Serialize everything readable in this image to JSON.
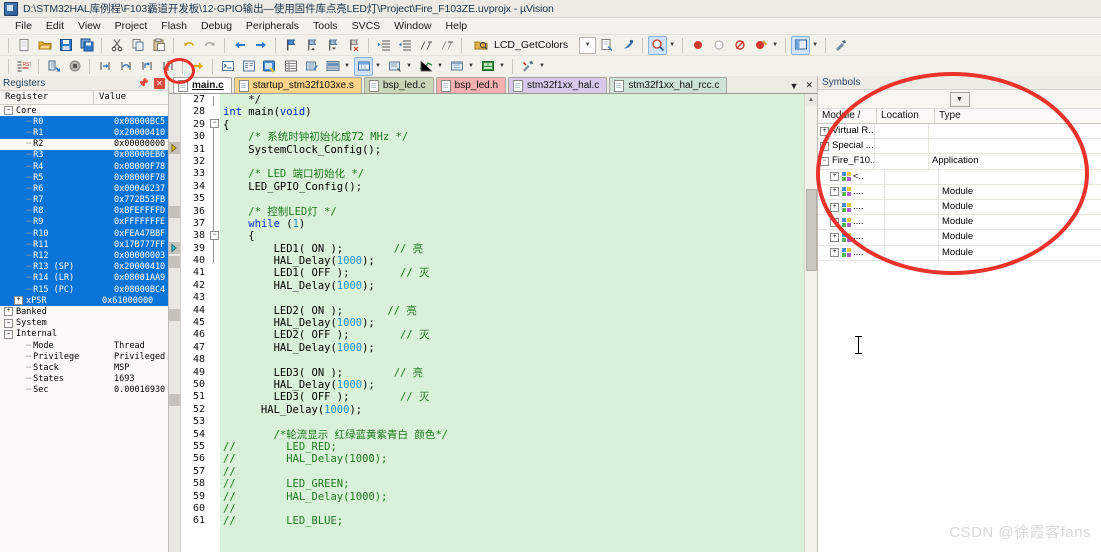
{
  "window": {
    "title": "D:\\STM32HAL库例程\\F103霸道开发板\\12-GPIO输出—使用固件库点亮LED灯\\Project\\Fire_F103ZE.uvprojx - µVision",
    "logo_name": "uvision-logo"
  },
  "menubar": {
    "items": [
      "File",
      "Edit",
      "View",
      "Project",
      "Flash",
      "Debug",
      "Peripherals",
      "Tools",
      "SVCS",
      "Window",
      "Help"
    ]
  },
  "toolbar1": {
    "combo_value": "LCD_GetColors",
    "icons": [
      "new-file-icon",
      "open-file-icon",
      "save-icon",
      "save-all-icon",
      "cut-icon",
      "copy-icon",
      "paste-icon",
      "undo-icon",
      "redo-icon",
      "navigate-back-icon",
      "navigate-forward-icon",
      "bookmark-toggle-icon",
      "bookmark-prev-icon",
      "bookmark-next-icon",
      "bookmark-clear-icon",
      "indent-icon",
      "outdent-icon",
      "comment-icon",
      "uncomment-icon",
      "find-in-files-icon"
    ],
    "right_icons": [
      "combo-dropdown-icon",
      "browse-symbol-icon",
      "insert-bookmark-icon",
      "find-icon",
      "breakpoint-icon",
      "disable-breakpoint-icon",
      "kill-all-breakpoints-icon",
      "disable-all-breakpoints-icon",
      "project-window-icon",
      "configure-icon"
    ]
  },
  "toolbar2": {
    "icons": [
      "reset-cpu-icon",
      "run-icon",
      "stop-icon",
      "step-icon",
      "step-over-icon",
      "step-out-icon",
      "run-to-cursor-icon",
      "show-next-statement-icon",
      "command-window-icon",
      "disassembly-window-icon",
      "symbols-window-icon",
      "registers-window-icon",
      "call-stack-icon",
      "watch-window-icon",
      "memory-window-icon",
      "serial-window-icon",
      "analysis-window-icon",
      "trace-window-icon",
      "system-viewer-icon",
      "toolbox-icon"
    ],
    "highlighted_icon": "symbols-window-icon"
  },
  "registers_pane": {
    "title": "Registers",
    "pin_icon": "pin-icon",
    "close_icon": "close-icon",
    "columns": [
      "Register",
      "Value"
    ],
    "rows": [
      {
        "name": "Core",
        "value": "",
        "indent": 0,
        "expander": "-",
        "selected": false
      },
      {
        "name": "R0",
        "value": "0x08000BC5",
        "indent": 2,
        "expander": "",
        "selected": true
      },
      {
        "name": "R1",
        "value": "0x20000410",
        "indent": 2,
        "expander": "",
        "selected": true
      },
      {
        "name": "R2",
        "value": "0x00000000",
        "indent": 2,
        "expander": "",
        "selected": false
      },
      {
        "name": "R3",
        "value": "0x08000EB6",
        "indent": 2,
        "expander": "",
        "selected": true
      },
      {
        "name": "R4",
        "value": "0x08000F78",
        "indent": 2,
        "expander": "",
        "selected": true
      },
      {
        "name": "R5",
        "value": "0x08000F78",
        "indent": 2,
        "expander": "",
        "selected": true
      },
      {
        "name": "R6",
        "value": "0x00046237",
        "indent": 2,
        "expander": "",
        "selected": true
      },
      {
        "name": "R7",
        "value": "0x772B53FB",
        "indent": 2,
        "expander": "",
        "selected": true
      },
      {
        "name": "R8",
        "value": "0xBFEFFFFD",
        "indent": 2,
        "expander": "",
        "selected": true
      },
      {
        "name": "R9",
        "value": "0xFFFFFFFE",
        "indent": 2,
        "expander": "",
        "selected": true
      },
      {
        "name": "R10",
        "value": "0xFEA47BBF",
        "indent": 2,
        "expander": "",
        "selected": true
      },
      {
        "name": "R11",
        "value": "0x17B777FF",
        "indent": 2,
        "expander": "",
        "selected": true
      },
      {
        "name": "R12",
        "value": "0x00000003",
        "indent": 2,
        "expander": "",
        "selected": true
      },
      {
        "name": "R13 (SP)",
        "value": "0x20000410",
        "indent": 2,
        "expander": "",
        "selected": true
      },
      {
        "name": "R14 (LR)",
        "value": "0x08001AA9",
        "indent": 2,
        "expander": "",
        "selected": true
      },
      {
        "name": "R15 (PC)",
        "value": "0x08000BC4",
        "indent": 2,
        "expander": "",
        "selected": true
      },
      {
        "name": "xPSR",
        "value": "0x61000000",
        "indent": 1,
        "expander": "+",
        "selected": true
      },
      {
        "name": "Banked",
        "value": "",
        "indent": 0,
        "expander": "+",
        "selected": false
      },
      {
        "name": "System",
        "value": "",
        "indent": 0,
        "expander": "-",
        "selected": false
      },
      {
        "name": "Internal",
        "value": "",
        "indent": 0,
        "expander": "-",
        "selected": false
      },
      {
        "name": "Mode",
        "value": "Thread",
        "indent": 2,
        "expander": "",
        "selected": false
      },
      {
        "name": "Privilege",
        "value": "Privileged",
        "indent": 2,
        "expander": "",
        "selected": false
      },
      {
        "name": "Stack",
        "value": "MSP",
        "indent": 2,
        "expander": "",
        "selected": false
      },
      {
        "name": "States",
        "value": "1693",
        "indent": 2,
        "expander": "",
        "selected": false
      },
      {
        "name": "Sec",
        "value": "0.00016930",
        "indent": 2,
        "expander": "",
        "selected": false
      }
    ]
  },
  "editor": {
    "tabs": [
      {
        "label": "main.c",
        "color": "#ffffff",
        "active": true
      },
      {
        "label": "startup_stm32f103xe.s",
        "color": "#fbd48a",
        "active": false
      },
      {
        "label": "bsp_led.c",
        "color": "#c9d7b8",
        "active": false
      },
      {
        "label": "bsp_led.h",
        "color": "#f4b0b0",
        "active": false
      },
      {
        "label": "stm32f1xx_hal.c",
        "color": "#d8c8ea",
        "active": false
      },
      {
        "label": "stm32f1xx_hal_rcc.c",
        "color": "#cfe2d6",
        "active": false
      }
    ],
    "tab_dropdown_icon": "chevron-down-icon",
    "tab_close_icon": "close-icon",
    "first_line": 27,
    "lines": [
      {
        "n": 27,
        "text": "    */"
      },
      {
        "n": 28,
        "text": "int main(void)"
      },
      {
        "n": 29,
        "text": "{"
      },
      {
        "n": 30,
        "text": "    /* 系统时钟初始化成72 MHz */"
      },
      {
        "n": 31,
        "text": "    SystemClock_Config();"
      },
      {
        "n": 32,
        "text": ""
      },
      {
        "n": 33,
        "text": "    /* LED 端口初始化 */"
      },
      {
        "n": 34,
        "text": "    LED_GPIO_Config();"
      },
      {
        "n": 35,
        "text": ""
      },
      {
        "n": 36,
        "text": "    /* 控制LED灯 */"
      },
      {
        "n": 37,
        "text": "    while (1)"
      },
      {
        "n": 38,
        "text": "    {"
      },
      {
        "n": 39,
        "text": "        LED1( ON );        // 亮"
      },
      {
        "n": 40,
        "text": "        HAL_Delay(1000);"
      },
      {
        "n": 41,
        "text": "        LED1( OFF );        // 灭"
      },
      {
        "n": 42,
        "text": "        HAL_Delay(1000);"
      },
      {
        "n": 43,
        "text": ""
      },
      {
        "n": 44,
        "text": "        LED2( ON );       // 亮"
      },
      {
        "n": 45,
        "text": "        HAL_Delay(1000);"
      },
      {
        "n": 46,
        "text": "        LED2( OFF );        // 灭"
      },
      {
        "n": 47,
        "text": "        HAL_Delay(1000);"
      },
      {
        "n": 48,
        "text": ""
      },
      {
        "n": 49,
        "text": "        LED3( ON );        // 亮"
      },
      {
        "n": 50,
        "text": "        HAL_Delay(1000);"
      },
      {
        "n": 51,
        "text": "        LED3( OFF );        // 灭"
      },
      {
        "n": 52,
        "text": "      HAL_Delay(1000);"
      },
      {
        "n": 53,
        "text": ""
      },
      {
        "n": 54,
        "text": "        /*轮流显示 红绿蓝黄紫青白 颜色*/"
      },
      {
        "n": 55,
        "text": "//        LED_RED;"
      },
      {
        "n": 56,
        "text": "//        HAL_Delay(1000);"
      },
      {
        "n": 57,
        "text": "//"
      },
      {
        "n": 58,
        "text": "//        LED_GREEN;"
      },
      {
        "n": 59,
        "text": "//        HAL_Delay(1000);"
      },
      {
        "n": 60,
        "text": "//"
      },
      {
        "n": 61,
        "text": "//        LED_BLUE;"
      }
    ]
  },
  "symbols_pane": {
    "title": "Symbols",
    "filter_icon": "chevron-down-icon",
    "columns": [
      "Module / N...",
      "Location",
      "Type"
    ],
    "rows": [
      {
        "name": "Virtual R...",
        "location": "",
        "type": "",
        "indent": 0,
        "expander": "+",
        "icon": ""
      },
      {
        "name": "Special ...",
        "location": "",
        "type": "",
        "indent": 0,
        "expander": "+",
        "icon": ""
      },
      {
        "name": "Fire_F10...",
        "location": "",
        "type": "Application",
        "indent": 0,
        "expander": "-",
        "icon": ""
      },
      {
        "name": "<..",
        "location": "",
        "type": "",
        "indent": 1,
        "expander": "+",
        "icon": "module-icon"
      },
      {
        "name": "....",
        "location": "",
        "type": "Module",
        "indent": 1,
        "expander": "+",
        "icon": "module-icon"
      },
      {
        "name": "....",
        "location": "",
        "type": "Module",
        "indent": 1,
        "expander": "+",
        "icon": "module-icon"
      },
      {
        "name": "....",
        "location": "",
        "type": "Module",
        "indent": 1,
        "expander": "+",
        "icon": "module-icon"
      },
      {
        "name": "....",
        "location": "",
        "type": "Module",
        "indent": 1,
        "expander": "+",
        "icon": "module-icon"
      },
      {
        "name": "....",
        "location": "",
        "type": "Module",
        "indent": 1,
        "expander": "+",
        "icon": "module-icon"
      }
    ]
  },
  "annotations": {
    "toolbar_circle_name": "red-ellipse-annotation-toolbar",
    "symbols_circle_name": "red-ellipse-annotation-symbols",
    "color": "#e8322a"
  },
  "watermark": {
    "text": "CSDN @徐霞客fans"
  }
}
